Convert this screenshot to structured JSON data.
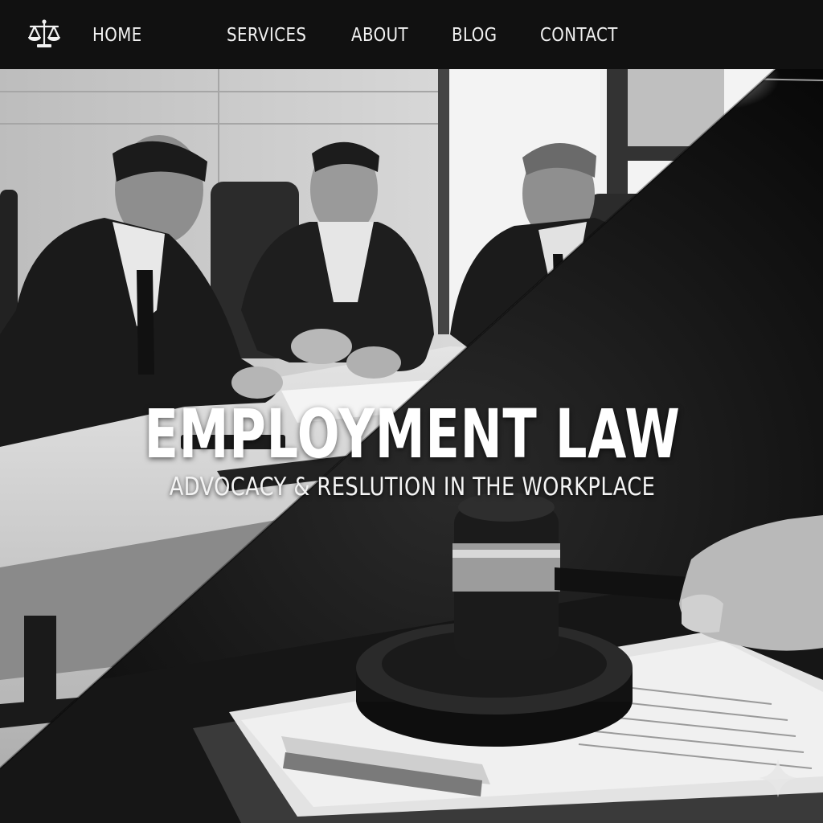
{
  "nav": {
    "logo_icon": "scales-of-justice-icon",
    "items": [
      {
        "label": "HOME"
      },
      {
        "label": "SERVICES"
      },
      {
        "label": "ABOUT"
      },
      {
        "label": "BLOG"
      },
      {
        "label": "CONTACT"
      }
    ]
  },
  "hero": {
    "title": "EMPLOYMENT LAW",
    "subtitle": "ADVOCACY & RESLUTION IN THE WORKPLACE",
    "image_left": "meeting-photo",
    "image_right": "gavel-photo",
    "corner_icon": "sparkle-icon"
  },
  "colors": {
    "nav_bg": "#111111",
    "nav_text": "#f2f2f2",
    "title_text": "#ffffff"
  }
}
